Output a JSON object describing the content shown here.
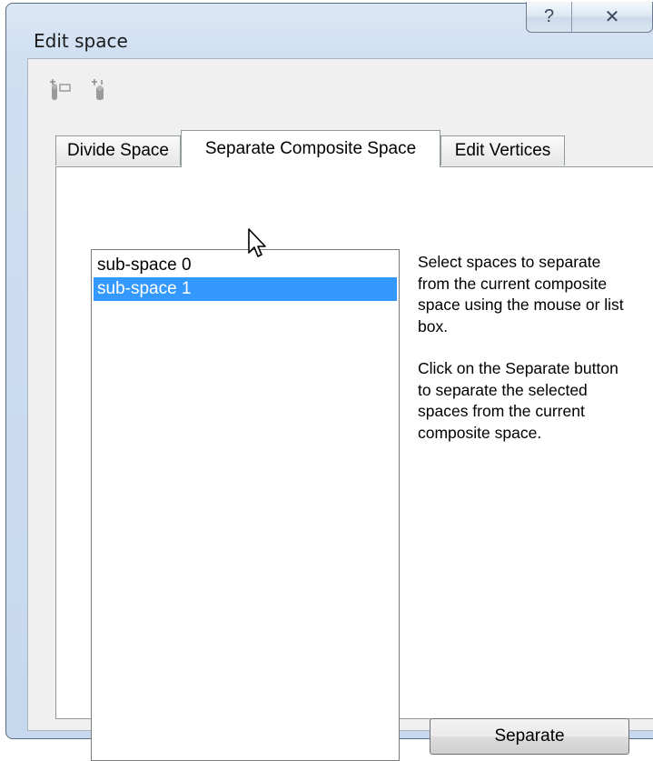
{
  "window": {
    "title": "Edit space",
    "help_glyph": "?",
    "close_glyph": "✕"
  },
  "toolbar": {
    "icons": [
      "add-vertex-icon",
      "move-vertex-icon"
    ]
  },
  "tabs": [
    {
      "label": "Divide Space",
      "active": false
    },
    {
      "label": "Separate Composite Space",
      "active": true
    },
    {
      "label": "Edit Vertices",
      "active": false
    }
  ],
  "listbox": {
    "items": [
      {
        "label": "sub-space 0",
        "selected": false
      },
      {
        "label": "sub-space 1",
        "selected": true
      }
    ]
  },
  "help": {
    "paragraph1": "Select spaces to separate from the current composite space using the mouse or list box.",
    "paragraph2": "Click on the Separate button to separate the selected spaces from the current composite space."
  },
  "buttons": {
    "separate_label": "Separate"
  },
  "colors": {
    "selection": "#3399ff",
    "frame": "#cfdff2"
  }
}
